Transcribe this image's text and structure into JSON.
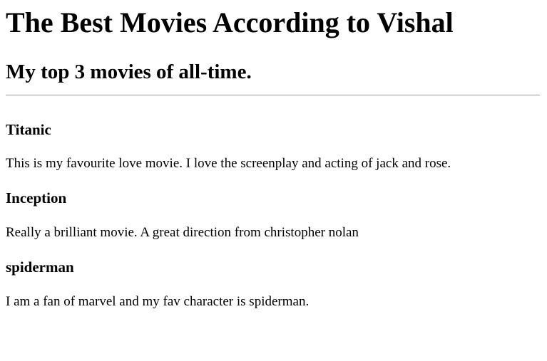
{
  "page": {
    "title": "The Best Movies According to Vishal",
    "subtitle": "My top 3 movies of all-time."
  },
  "movies": [
    {
      "title": "Titanic",
      "description": "This is my favourite love movie. I love the screenplay and acting of jack and rose."
    },
    {
      "title": "Inception",
      "description": "Really a brilliant movie. A great direction from christopher nolan"
    },
    {
      "title": "spiderman",
      "description": "I am a fan of marvel and my fav character is spiderman."
    }
  ]
}
